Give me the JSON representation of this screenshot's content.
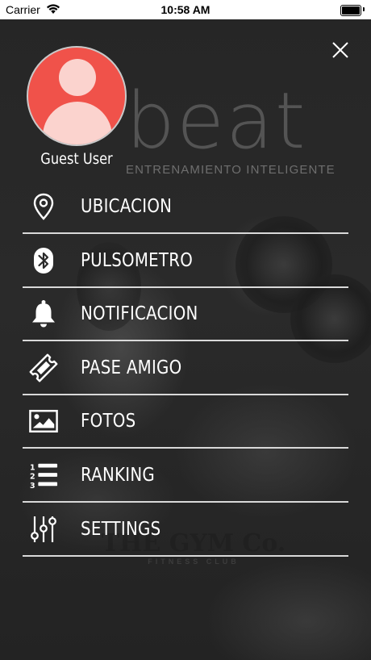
{
  "status_bar": {
    "carrier": "Carrier",
    "time": "10:58 AM",
    "icons": [
      "wifi-icon",
      "battery-icon"
    ]
  },
  "background": {
    "brand_word": "beat",
    "brand_tagline": "ENTRENAMIENTO INTELIGENTE",
    "gym_name": "THE GYM Co.",
    "gym_subtitle": "FITNESS CLUB"
  },
  "profile": {
    "name": "Guest User",
    "avatar_color": "#f0524a",
    "avatar_figure_color": "#fbd3ce"
  },
  "menu": {
    "items": [
      {
        "label": "UBICACION",
        "icon": "map-pin-icon"
      },
      {
        "label": "PULSOMETRO",
        "icon": "bluetooth-icon"
      },
      {
        "label": "NOTIFICACION",
        "icon": "bell-icon"
      },
      {
        "label": "PASE AMIGO",
        "icon": "ticket-icon"
      },
      {
        "label": "FOTOS",
        "icon": "photo-icon"
      },
      {
        "label": "RANKING",
        "icon": "ranking-list-icon"
      },
      {
        "label": "SETTINGS",
        "icon": "sliders-icon"
      }
    ]
  },
  "colors": {
    "overlay_text": "#ffffff",
    "divider": "#d9d9d9",
    "background": "#1e1e1e"
  }
}
